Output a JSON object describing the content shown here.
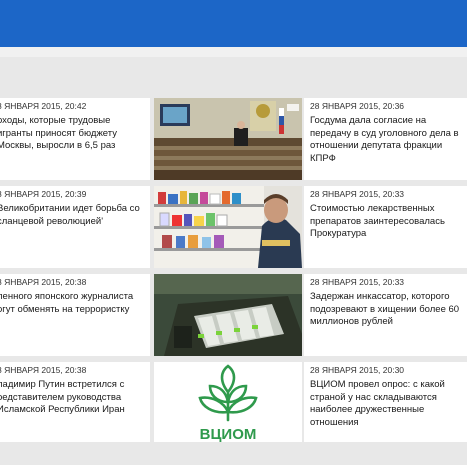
{
  "colors": {
    "accent": "#1c66c7",
    "background": "#e8e8e8",
    "tile": "#ffffff",
    "vciom_green": "#2f9a4c"
  },
  "news": {
    "left": [
      {
        "time": "8 ЯНВАРЯ 2015, 20:42",
        "headline": "оходы, которые трудовые игранты приносят бюджету Москвы, выросли в 6,5 раз"
      },
      {
        "time": "8 ЯНВАРЯ 2015, 20:39",
        "headline": "Великобритании идет борьба со сланцевой революцией'"
      },
      {
        "time": "8 ЯНВАРЯ 2015, 20:38",
        "headline": "ленного японского журналиста огут обменять на террористку"
      },
      {
        "time": "8 ЯНВАРЯ 2015, 20:38",
        "headline": "ладимир Путин встретился с редставителем руководства Исламской Республики Иран"
      }
    ],
    "right": [
      {
        "time": "28 ЯНВАРЯ 2015, 20:36",
        "headline": "Госдума дала согласие на передачу в суд уголовного дела в отношении депутата фракции КПРФ"
      },
      {
        "time": "28 ЯНВАРЯ 2015, 20:33",
        "headline": "Стоимостью лекарственных препаратов заинтересовалась Прокуратура"
      },
      {
        "time": "28 ЯНВАРЯ 2015, 20:33",
        "headline": "Задержан инкассатор, которого подозревают в хищении более 60 миллионов рублей"
      },
      {
        "time": "28 ЯНВАРЯ 2015, 20:30",
        "headline": "ВЦИОМ провел опрос: с какой страной у нас складываются наиболее дружественные отношения"
      }
    ],
    "images": [
      {
        "icon": "duma-hall-photo"
      },
      {
        "icon": "pharmacy-photo"
      },
      {
        "icon": "cash-cassettes-photo"
      },
      {
        "icon": "vciom-logo",
        "logo_text": "ВЦИОМ"
      }
    ]
  }
}
